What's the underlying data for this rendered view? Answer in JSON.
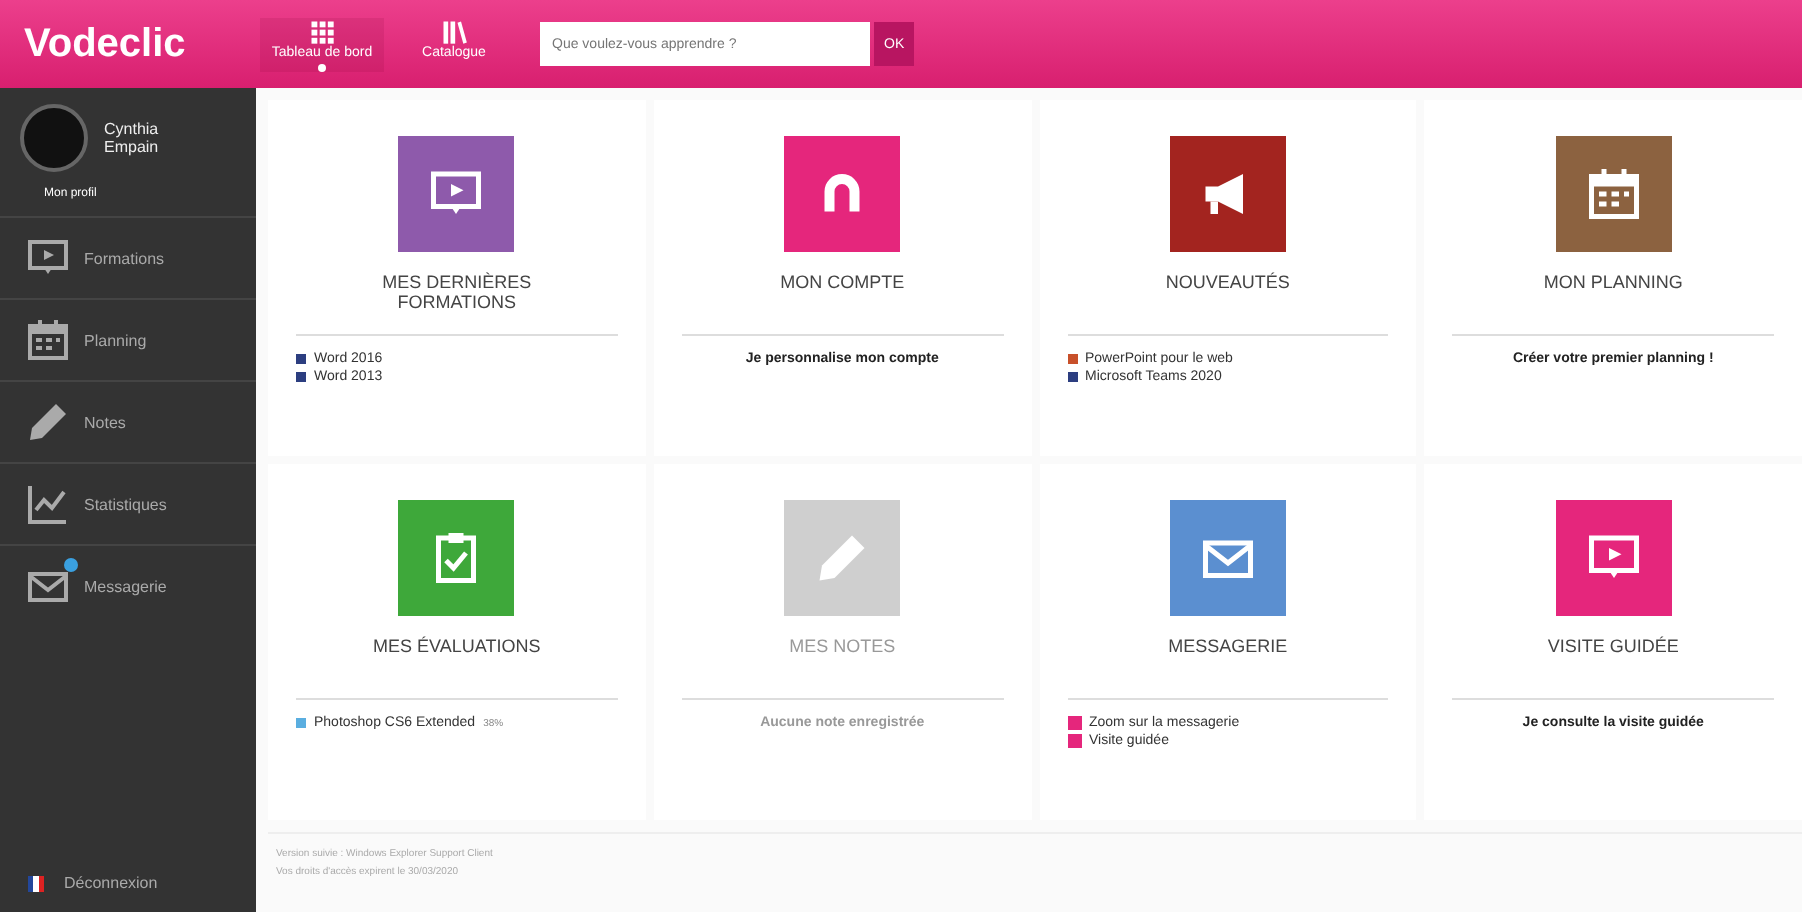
{
  "header": {
    "logo": "Vodeclic",
    "nav": [
      {
        "label": "Tableau de bord",
        "selected": true
      },
      {
        "label": "Catalogue",
        "selected": false
      }
    ],
    "search": {
      "placeholder": "Que voulez-vous apprendre ?",
      "button": "OK"
    }
  },
  "sidebar": {
    "user": {
      "name": "Cynthia Empain",
      "profile_link": "Mon profil"
    },
    "items": [
      {
        "label": "Formations",
        "badge": false
      },
      {
        "label": "Planning",
        "badge": false
      },
      {
        "label": "Notes",
        "badge": false
      },
      {
        "label": "Statistiques",
        "badge": false
      },
      {
        "label": "Messagerie",
        "badge": true
      }
    ],
    "logout": "Déconnexion"
  },
  "tiles": [
    {
      "title": "MES DERNIÈRES FORMATIONS",
      "color": "#8e5aab",
      "disabled": false,
      "kind": "list",
      "lines": [
        {
          "text": "Word 2016",
          "color": "#2c3e80"
        },
        {
          "text": "Word 2013",
          "color": "#2c3e80"
        }
      ]
    },
    {
      "title": "MON COMPTE",
      "color": "#e5267c",
      "disabled": false,
      "kind": "link",
      "lines": [
        {
          "text": "Je personnalise mon compte"
        }
      ]
    },
    {
      "title": "NOUVEAUTÉS",
      "color": "#a3241f",
      "disabled": false,
      "kind": "list",
      "lines": [
        {
          "text": "PowerPoint pour le web",
          "color": "#c8502a"
        },
        {
          "text": "Microsoft Teams 2020",
          "color": "#2c3e80"
        }
      ]
    },
    {
      "title": "MON PLANNING",
      "color": "#8c6240",
      "disabled": false,
      "kind": "link",
      "lines": [
        {
          "text": "Créer votre premier planning !"
        }
      ]
    },
    {
      "title": "MES ÉVALUATIONS",
      "color": "#3ea83a",
      "disabled": false,
      "kind": "list",
      "lines": [
        {
          "text": "Photoshop CS6 Extended",
          "color": "#5aaee0",
          "note": "38%"
        }
      ]
    },
    {
      "title": "MES NOTES",
      "color": "#cfcfcf",
      "disabled": true,
      "kind": "link",
      "lines": [
        {
          "text": "Aucune note enregistrée"
        }
      ]
    },
    {
      "title": "MESSAGERIE",
      "color": "#5b8fd0",
      "disabled": false,
      "kind": "boxed",
      "lines": [
        {
          "text": "Zoom sur la messagerie",
          "color": "#e5267c"
        },
        {
          "text": "Visite guidée",
          "color": "#e5267c"
        }
      ]
    },
    {
      "title": "VISITE GUIDÉE",
      "color": "#e5267c",
      "disabled": false,
      "kind": "link",
      "lines": [
        {
          "text": "Je consulte la visite guidée"
        }
      ]
    }
  ],
  "footer": [
    "Version suivie : Windows Explorer Support Client",
    "Vos droits d'accès expirent le 30/03/2020"
  ]
}
